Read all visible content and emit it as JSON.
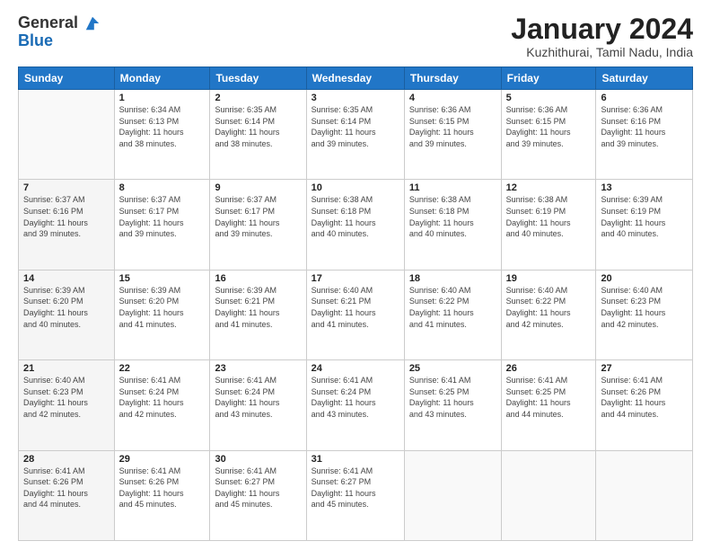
{
  "header": {
    "logo_line1": "General",
    "logo_line2": "Blue",
    "title": "January 2024",
    "subtitle": "Kuzhithurai, Tamil Nadu, India"
  },
  "weekdays": [
    "Sunday",
    "Monday",
    "Tuesday",
    "Wednesday",
    "Thursday",
    "Friday",
    "Saturday"
  ],
  "weeks": [
    [
      {
        "day": "",
        "info": ""
      },
      {
        "day": "1",
        "info": "Sunrise: 6:34 AM\nSunset: 6:13 PM\nDaylight: 11 hours\nand 38 minutes."
      },
      {
        "day": "2",
        "info": "Sunrise: 6:35 AM\nSunset: 6:14 PM\nDaylight: 11 hours\nand 38 minutes."
      },
      {
        "day": "3",
        "info": "Sunrise: 6:35 AM\nSunset: 6:14 PM\nDaylight: 11 hours\nand 39 minutes."
      },
      {
        "day": "4",
        "info": "Sunrise: 6:36 AM\nSunset: 6:15 PM\nDaylight: 11 hours\nand 39 minutes."
      },
      {
        "day": "5",
        "info": "Sunrise: 6:36 AM\nSunset: 6:15 PM\nDaylight: 11 hours\nand 39 minutes."
      },
      {
        "day": "6",
        "info": "Sunrise: 6:36 AM\nSunset: 6:16 PM\nDaylight: 11 hours\nand 39 minutes."
      }
    ],
    [
      {
        "day": "7",
        "info": "Sunrise: 6:37 AM\nSunset: 6:16 PM\nDaylight: 11 hours\nand 39 minutes."
      },
      {
        "day": "8",
        "info": "Sunrise: 6:37 AM\nSunset: 6:17 PM\nDaylight: 11 hours\nand 39 minutes."
      },
      {
        "day": "9",
        "info": "Sunrise: 6:37 AM\nSunset: 6:17 PM\nDaylight: 11 hours\nand 39 minutes."
      },
      {
        "day": "10",
        "info": "Sunrise: 6:38 AM\nSunset: 6:18 PM\nDaylight: 11 hours\nand 40 minutes."
      },
      {
        "day": "11",
        "info": "Sunrise: 6:38 AM\nSunset: 6:18 PM\nDaylight: 11 hours\nand 40 minutes."
      },
      {
        "day": "12",
        "info": "Sunrise: 6:38 AM\nSunset: 6:19 PM\nDaylight: 11 hours\nand 40 minutes."
      },
      {
        "day": "13",
        "info": "Sunrise: 6:39 AM\nSunset: 6:19 PM\nDaylight: 11 hours\nand 40 minutes."
      }
    ],
    [
      {
        "day": "14",
        "info": "Sunrise: 6:39 AM\nSunset: 6:20 PM\nDaylight: 11 hours\nand 40 minutes."
      },
      {
        "day": "15",
        "info": "Sunrise: 6:39 AM\nSunset: 6:20 PM\nDaylight: 11 hours\nand 41 minutes."
      },
      {
        "day": "16",
        "info": "Sunrise: 6:39 AM\nSunset: 6:21 PM\nDaylight: 11 hours\nand 41 minutes."
      },
      {
        "day": "17",
        "info": "Sunrise: 6:40 AM\nSunset: 6:21 PM\nDaylight: 11 hours\nand 41 minutes."
      },
      {
        "day": "18",
        "info": "Sunrise: 6:40 AM\nSunset: 6:22 PM\nDaylight: 11 hours\nand 41 minutes."
      },
      {
        "day": "19",
        "info": "Sunrise: 6:40 AM\nSunset: 6:22 PM\nDaylight: 11 hours\nand 42 minutes."
      },
      {
        "day": "20",
        "info": "Sunrise: 6:40 AM\nSunset: 6:23 PM\nDaylight: 11 hours\nand 42 minutes."
      }
    ],
    [
      {
        "day": "21",
        "info": "Sunrise: 6:40 AM\nSunset: 6:23 PM\nDaylight: 11 hours\nand 42 minutes."
      },
      {
        "day": "22",
        "info": "Sunrise: 6:41 AM\nSunset: 6:24 PM\nDaylight: 11 hours\nand 42 minutes."
      },
      {
        "day": "23",
        "info": "Sunrise: 6:41 AM\nSunset: 6:24 PM\nDaylight: 11 hours\nand 43 minutes."
      },
      {
        "day": "24",
        "info": "Sunrise: 6:41 AM\nSunset: 6:24 PM\nDaylight: 11 hours\nand 43 minutes."
      },
      {
        "day": "25",
        "info": "Sunrise: 6:41 AM\nSunset: 6:25 PM\nDaylight: 11 hours\nand 43 minutes."
      },
      {
        "day": "26",
        "info": "Sunrise: 6:41 AM\nSunset: 6:25 PM\nDaylight: 11 hours\nand 44 minutes."
      },
      {
        "day": "27",
        "info": "Sunrise: 6:41 AM\nSunset: 6:26 PM\nDaylight: 11 hours\nand 44 minutes."
      }
    ],
    [
      {
        "day": "28",
        "info": "Sunrise: 6:41 AM\nSunset: 6:26 PM\nDaylight: 11 hours\nand 44 minutes."
      },
      {
        "day": "29",
        "info": "Sunrise: 6:41 AM\nSunset: 6:26 PM\nDaylight: 11 hours\nand 45 minutes."
      },
      {
        "day": "30",
        "info": "Sunrise: 6:41 AM\nSunset: 6:27 PM\nDaylight: 11 hours\nand 45 minutes."
      },
      {
        "day": "31",
        "info": "Sunrise: 6:41 AM\nSunset: 6:27 PM\nDaylight: 11 hours\nand 45 minutes."
      },
      {
        "day": "",
        "info": ""
      },
      {
        "day": "",
        "info": ""
      },
      {
        "day": "",
        "info": ""
      }
    ]
  ]
}
